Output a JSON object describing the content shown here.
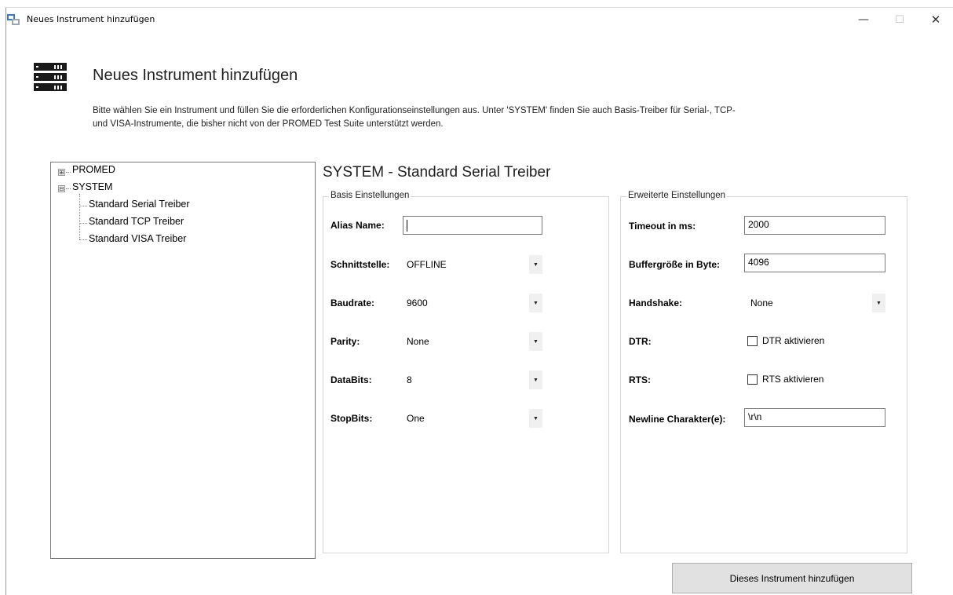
{
  "window": {
    "title": "Neues Instrument hinzufügen",
    "minimize_glyph": "—",
    "maximize_glyph": "☐",
    "close_glyph": "✕"
  },
  "header": {
    "title": "Neues Instrument hinzufügen",
    "description": "Bitte wählen Sie ein Instrument und füllen Sie die erforderlichen Konfigurationseinstellungen aus. Unter 'SYSTEM' finden Sie auch Basis-Treiber für Serial-, TCP- und VISA-Instrumente, die bisher nicht von der PROMED Test Suite unterstützt werden.",
    "icon": "server-rack-icon"
  },
  "tree": {
    "nodes": [
      {
        "label": "PROMED",
        "expander": "⊞"
      },
      {
        "label": "SYSTEM",
        "expander": "⊟"
      }
    ],
    "children": [
      {
        "label": "Standard Serial Treiber"
      },
      {
        "label": "Standard TCP Treiber"
      },
      {
        "label": "Standard VISA Treiber"
      }
    ]
  },
  "driver": {
    "title": "SYSTEM - Standard Serial Treiber"
  },
  "basis": {
    "legend": "Basis Einstellungen",
    "alias_label": "Alias Name:",
    "alias_value": "",
    "schnittstelle_label": "Schnittstelle:",
    "schnittstelle_value": "OFFLINE",
    "baudrate_label": "Baudrate:",
    "baudrate_value": "9600",
    "parity_label": "Parity:",
    "parity_value": "None",
    "databits_label": "DataBits:",
    "databits_value": "8",
    "stopbits_label": "StopBits:",
    "stopbits_value": "One",
    "dropdown_glyph": "▼"
  },
  "erweitert": {
    "legend": "Erweiterte Einstellungen",
    "timeout_label": "Timeout in ms:",
    "timeout_value": "2000",
    "buffer_label": "Buffergröße in Byte:",
    "buffer_value": "4096",
    "handshake_label": "Handshake:",
    "handshake_value": "None",
    "dtr_label": "DTR:",
    "dtr_checkbox": "DTR aktivieren",
    "rts_label": "RTS:",
    "rts_checkbox": "RTS aktivieren",
    "newline_label": "Newline Charakter(e):",
    "newline_value": "\\r\\n"
  },
  "actions": {
    "add_button": "Dieses Instrument hinzufügen"
  },
  "colors": {
    "button_bg": "#e1e1e1",
    "border": "#7a7a7a",
    "group_border": "#d6d6d6"
  }
}
